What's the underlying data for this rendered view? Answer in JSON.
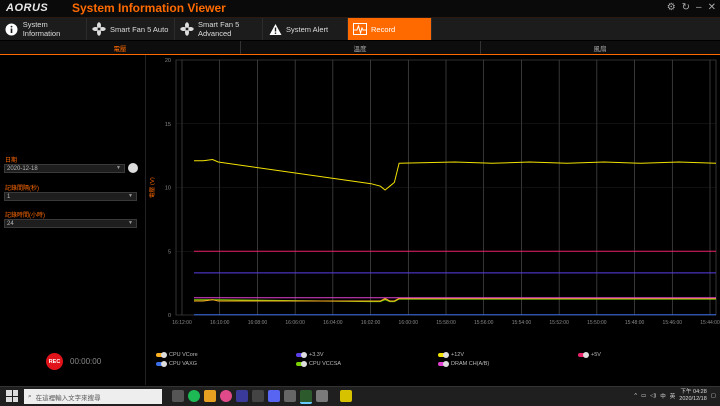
{
  "app": {
    "logo": "AORUS",
    "title": "System Information Viewer"
  },
  "tabs": [
    {
      "label": "System Information",
      "icon": "info-icon"
    },
    {
      "label": "Smart Fan 5 Auto",
      "icon": "fan-icon"
    },
    {
      "label": "Smart Fan 5 Advanced",
      "icon": "fan-icon"
    },
    {
      "label": "System Alert",
      "icon": "warning-icon"
    },
    {
      "label": "Record",
      "icon": "record-chart-icon",
      "active": true
    }
  ],
  "subtabs": [
    "電壓",
    "溫度",
    "風扇"
  ],
  "left": {
    "date_label": "日期",
    "date_value": "2020-12-18",
    "interval_label": "記錄間隔(秒)",
    "interval_value": "1",
    "duration_label": "記錄時間(小時)",
    "duration_value": "24",
    "rec_label": "REC",
    "rec_time": "00:00:00"
  },
  "chart_data": {
    "type": "line",
    "ylabel": "電壓 (V)",
    "ylim": [
      0,
      20
    ],
    "yticks": [
      0,
      5,
      10,
      15,
      20
    ],
    "xticks": [
      "16:12:00",
      "16:10:00",
      "16:08:00",
      "16:06:00",
      "16:04:00",
      "16:02:00",
      "16:00:00",
      "15:58:00",
      "15:56:00",
      "15:54:00",
      "15:52:00",
      "15:50:00",
      "15:48:00",
      "15:46:00",
      "15:44:00"
    ],
    "x": [
      0,
      0.5,
      1,
      1.3,
      9.5,
      10.0,
      10.25,
      10.5,
      10.75,
      11,
      14,
      16,
      18,
      20,
      22,
      24,
      26,
      28
    ],
    "x_note": "",
    "series": [
      {
        "name": "+12V",
        "color": "#f2e200",
        "values": [
          12.1,
          12.1,
          12.2,
          12.0,
          10.3,
          10.1,
          9.8,
          10.1,
          10.4,
          11.9,
          12.0,
          11.9,
          12.0,
          11.9,
          12.0,
          11.9,
          12.0,
          11.9
        ]
      },
      {
        "name": "+5V",
        "color": "#e8236a",
        "values": [
          5.0,
          5.0,
          5.0,
          5.0,
          5.0,
          5.0,
          5.0,
          5.0,
          5.0,
          5.0,
          5.0,
          5.0,
          5.0,
          5.0,
          5.0,
          5.0,
          5.0,
          5.0
        ]
      },
      {
        "name": "+3.3V",
        "color": "#5a3ee8",
        "values": [
          3.3,
          3.3,
          3.3,
          3.3,
          3.3,
          3.3,
          3.3,
          3.3,
          3.3,
          3.3,
          3.3,
          3.3,
          3.3,
          3.3,
          3.3,
          3.3,
          3.3,
          3.3
        ]
      },
      {
        "name": "CPU VCCSA",
        "color": "#7ad000",
        "values": [
          1.2,
          1.2,
          1.2,
          1.2,
          1.05,
          1.05,
          1.2,
          1.05,
          1.05,
          1.25,
          1.25,
          1.25,
          1.25,
          1.25,
          1.25,
          1.25,
          1.25,
          1.25
        ]
      },
      {
        "name": "CPU VCore",
        "color": "#ffb020",
        "values": [
          1.1,
          1.1,
          1.2,
          1.1,
          1.1,
          1.1,
          1.3,
          1.1,
          1.1,
          1.3,
          1.3,
          1.3,
          1.3,
          1.3,
          1.3,
          1.3,
          1.3,
          1.3
        ]
      },
      {
        "name": "DRAM CH(A/B)",
        "color": "#e040d0",
        "values": [
          1.35,
          1.35,
          1.35,
          1.35,
          1.35,
          1.35,
          1.35,
          1.35,
          1.35,
          1.35,
          1.35,
          1.35,
          1.35,
          1.35,
          1.35,
          1.35,
          1.35,
          1.35
        ]
      },
      {
        "name": "CPU VAXG",
        "color": "#3a6ee8",
        "values": [
          0.02,
          0.02,
          0.02,
          0.02,
          0.02,
          0.02,
          0.02,
          0.02,
          0.02,
          0.02,
          0.02,
          0.02,
          0.02,
          0.02,
          0.02,
          0.02,
          0.02,
          0.02
        ]
      }
    ],
    "legend_order": [
      {
        "name": "CPU VCore",
        "color": "#ffb020"
      },
      {
        "name": "+3.3V",
        "color": "#5a3ee8"
      },
      {
        "name": "+12V",
        "color": "#f2e200"
      },
      {
        "name": "+5V",
        "color": "#e8236a"
      },
      {
        "name": "CPU VAXG",
        "color": "#3a6ee8"
      },
      {
        "name": "CPU VCCSA",
        "color": "#7ad000"
      },
      {
        "name": "DRAM CH(A/B)",
        "color": "#e040d0"
      }
    ]
  },
  "taskbar": {
    "search_placeholder": "在這裡輸入文字來搜尋",
    "time": "下午 04:28",
    "date": "2020/12/18",
    "ime": "中",
    "ime2": "英"
  }
}
